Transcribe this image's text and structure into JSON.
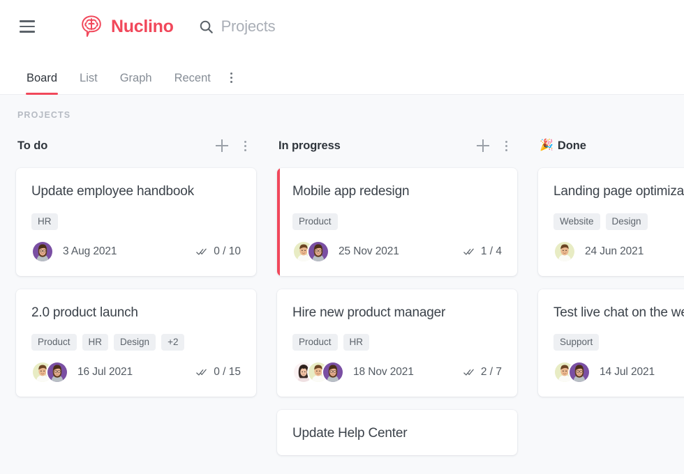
{
  "app": {
    "brand_name": "Nuclino",
    "brand_color": "#f1485b",
    "background_color": "#f8f9fb",
    "menu_icon": "hamburger-menu-icon",
    "logo_icon": "nuclino-brain-logo-icon"
  },
  "search": {
    "icon": "search-icon",
    "value": "Projects"
  },
  "tabs": {
    "items": [
      {
        "label": "Board",
        "active": true
      },
      {
        "label": "List",
        "active": false
      },
      {
        "label": "Graph",
        "active": false
      },
      {
        "label": "Recent",
        "active": false
      }
    ],
    "more_icon": "kebab-menu-icon"
  },
  "breadcrumb": "PROJECTS",
  "board": {
    "columns": [
      {
        "emoji": "",
        "title": "To do",
        "add_icon": "plus-icon",
        "menu_icon": "kebab-menu-icon",
        "cards": [
          {
            "title": "Update employee handbook",
            "accent": false,
            "tags": [
              "HR"
            ],
            "avatars": [
              "woman-purple"
            ],
            "date": "3 Aug 2021",
            "tasks": "0 / 10",
            "tasks_icon": "double-check-icon"
          },
          {
            "title": "2.0 product launch",
            "accent": false,
            "tags": [
              "Product",
              "HR",
              "Design",
              "+2"
            ],
            "avatars": [
              "man-cream",
              "woman-purple"
            ],
            "date": "16 Jul 2021",
            "tasks": "0 / 15",
            "tasks_icon": "double-check-icon"
          }
        ]
      },
      {
        "emoji": "",
        "title": "In progress",
        "add_icon": "plus-icon",
        "menu_icon": "kebab-menu-icon",
        "cards": [
          {
            "title": "Mobile app redesign",
            "accent": true,
            "tags": [
              "Product"
            ],
            "avatars": [
              "man-cream",
              "woman-purple"
            ],
            "date": "25 Nov 2021",
            "tasks": "1 / 4",
            "tasks_icon": "double-check-icon"
          },
          {
            "title": "Hire new product manager",
            "accent": false,
            "tags": [
              "Product",
              "HR"
            ],
            "avatars": [
              "woman-pink",
              "man-cream",
              "woman-purple"
            ],
            "date": "18 Nov 2021",
            "tasks": "2 / 7",
            "tasks_icon": "double-check-icon"
          },
          {
            "title": "Update Help Center",
            "accent": false,
            "tags": [],
            "avatars": [],
            "date": "",
            "tasks": "",
            "tasks_icon": ""
          }
        ]
      },
      {
        "emoji": "🎉",
        "title": "Done",
        "add_icon": "",
        "menu_icon": "",
        "cards": [
          {
            "title": "Landing page optimization",
            "accent": false,
            "tags": [
              "Website",
              "Design"
            ],
            "avatars": [
              "man-cream"
            ],
            "date": "24 Jun 2021",
            "tasks": "",
            "tasks_icon": ""
          },
          {
            "title": "Test live chat on the website",
            "accent": false,
            "tags": [
              "Support"
            ],
            "avatars": [
              "man-cream",
              "woman-purple"
            ],
            "date": "14 Jul 2021",
            "tasks": "",
            "tasks_icon": ""
          }
        ]
      }
    ]
  }
}
